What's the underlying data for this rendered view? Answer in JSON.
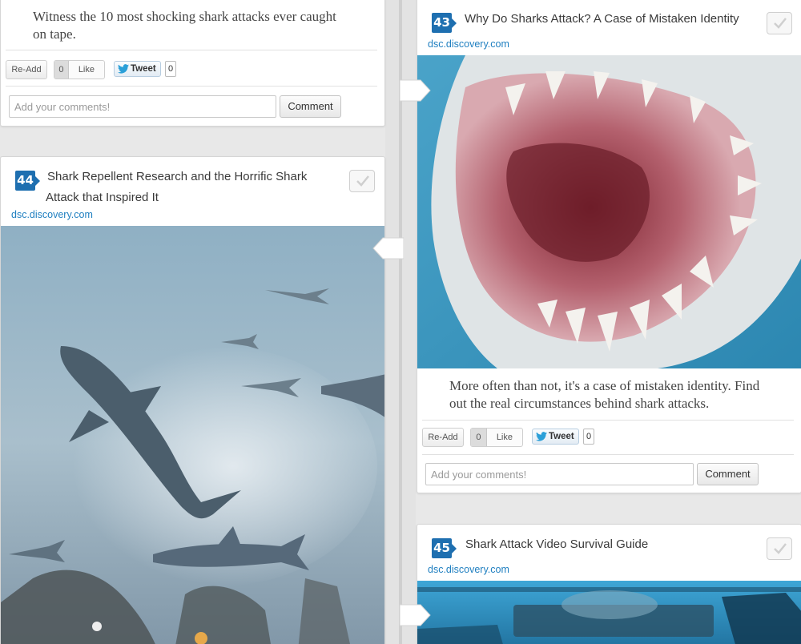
{
  "cards": {
    "prev": {
      "description": "Witness the 10 most shocking shark attacks ever caught on tape.",
      "readd_label": "Re-Add",
      "like_count": "0",
      "like_label": "Like",
      "tweet_label": "Tweet",
      "tweet_count": "0",
      "comment_placeholder": "Add your comments!",
      "comment_button": "Comment"
    },
    "c43": {
      "number": "43",
      "title": "Why Do Sharks Attack? A Case of Mistaken Identity",
      "source": "dsc.discovery.com",
      "description": "More often than not, it's a case of mistaken identity. Find out the real circumstances behind shark attacks.",
      "readd_label": "Re-Add",
      "like_count": "0",
      "like_label": "Like",
      "tweet_label": "Tweet",
      "tweet_count": "0",
      "comment_placeholder": "Add your comments!",
      "comment_button": "Comment"
    },
    "c44": {
      "number": "44",
      "title_line1": "Shark Repellent Research and the Horrific Shark",
      "title_line2": "Attack that Inspired It",
      "source": "dsc.discovery.com"
    },
    "c45": {
      "number": "45",
      "title": "Shark Attack Video Survival Guide",
      "source": "dsc.discovery.com"
    }
  },
  "colors": {
    "accent": "#1e6fb0",
    "link": "#1f7fc0",
    "background": "#e8e8e8"
  },
  "icons": [
    "video-number-icon",
    "check-icon",
    "twitter-bird-icon",
    "timeline-arrow-icon"
  ]
}
